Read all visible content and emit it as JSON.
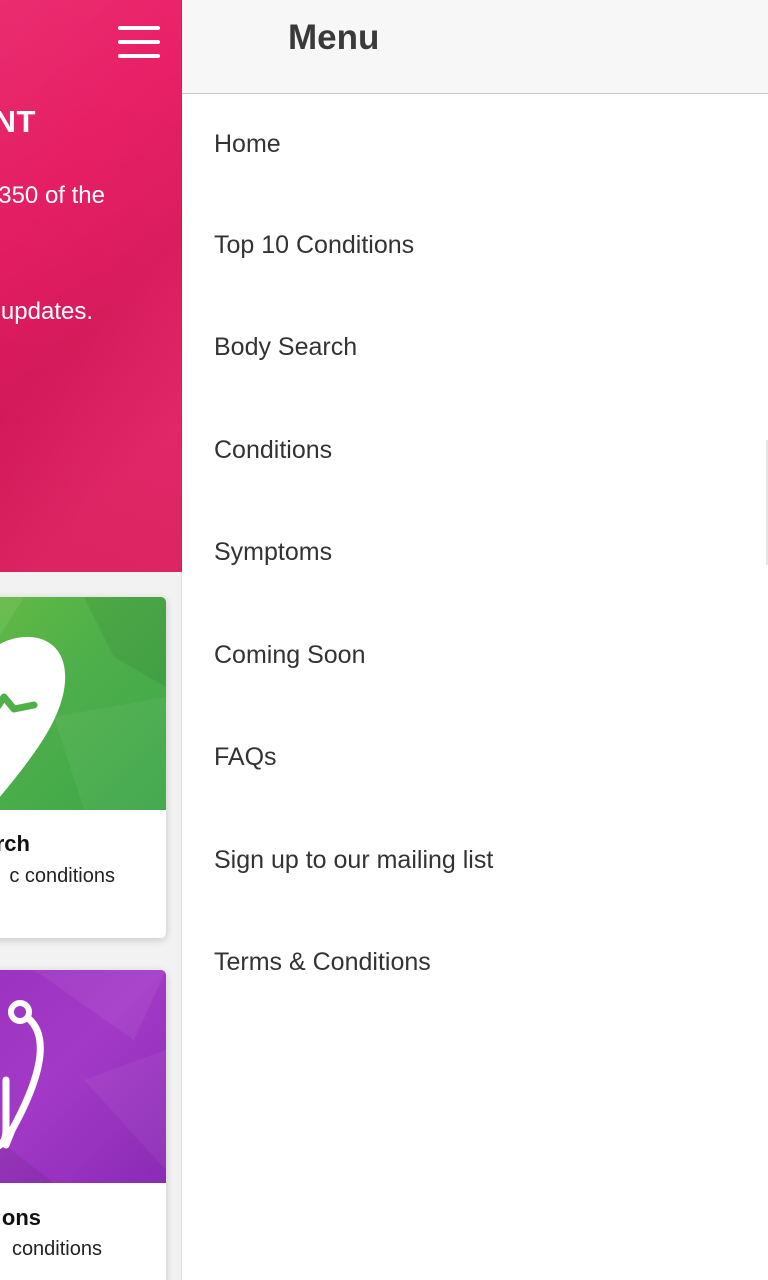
{
  "background": {
    "hero": {
      "title": "NT",
      "line1": "350 of the",
      "line2": "updates."
    },
    "cards": [
      {
        "title": "rch",
        "subtitle": "c conditions",
        "color": "#4fb04a",
        "icon": "heart-pulse-icon"
      },
      {
        "title": "ons",
        "subtitle": "conditions",
        "color": "#a33ac7",
        "icon": "stethoscope-icon"
      }
    ],
    "accent": "#e51e63"
  },
  "drawer": {
    "title": "Menu",
    "items": [
      {
        "label": "Home"
      },
      {
        "label": "Top 10 Conditions"
      },
      {
        "label": "Body Search"
      },
      {
        "label": "Conditions"
      },
      {
        "label": "Symptoms"
      },
      {
        "label": "Coming Soon"
      },
      {
        "label": "FAQs"
      },
      {
        "label": "Sign up to our mailing list"
      },
      {
        "label": "Terms & Conditions"
      }
    ]
  }
}
